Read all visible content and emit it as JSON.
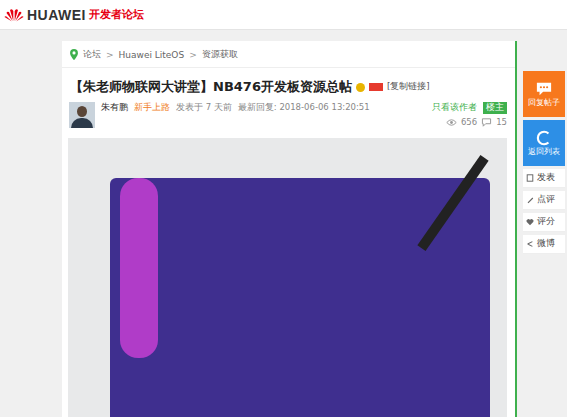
{
  "header": {
    "brand": "HUAWEI",
    "subtitle": "开发者论坛"
  },
  "breadcrumb": {
    "items": [
      "论坛",
      "Huawei LiteOS",
      "资源获取"
    ],
    "separator": ">"
  },
  "post": {
    "title": "【朱老师物联网大讲堂】NB476开发板资源总帖",
    "copy_link": "[复制链接]",
    "author": "朱有鹏",
    "rank": "新手上路",
    "posted": "发表于 7 天前",
    "last_reply": "最新回复: 2018-06-06 13:20:51",
    "only_author": "只看该作者",
    "floor": "楼主",
    "views": "656",
    "replies": "15"
  },
  "side_buttons": [
    {
      "label": "回复帖子",
      "kind": "reply",
      "color": "#f7781d"
    },
    {
      "label": "返回列表",
      "kind": "back",
      "color": "#2d8fe6"
    }
  ],
  "side_links": [
    {
      "label": "发表",
      "kind": "post"
    },
    {
      "label": "点评",
      "kind": "comment"
    },
    {
      "label": "评分",
      "kind": "rate"
    },
    {
      "label": "微博",
      "kind": "share"
    }
  ]
}
